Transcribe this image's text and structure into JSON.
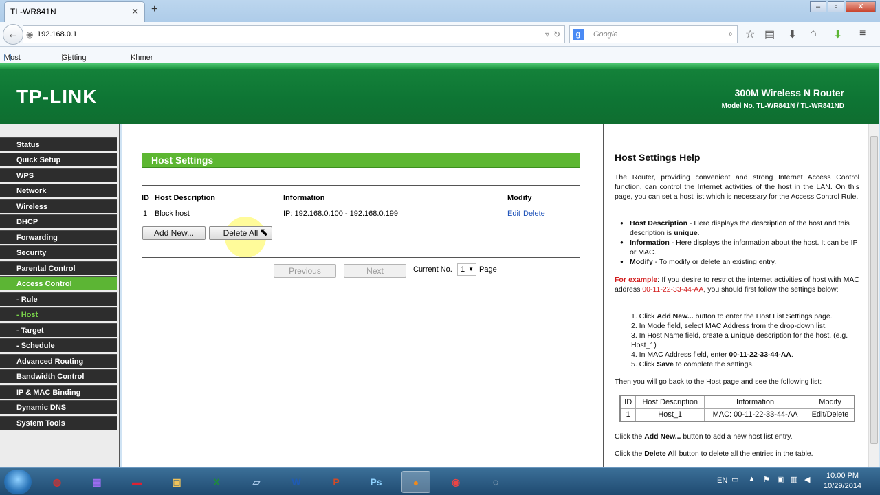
{
  "browser": {
    "tab_title": "TL-WR841N",
    "url": "192.168.0.1",
    "search_placeholder": "Google",
    "bookmarks": [
      "Most Visited",
      "Getting Started",
      "Khmer"
    ]
  },
  "header": {
    "logo": "TP-LINK",
    "product": "300M Wireless N Router",
    "model": "Model No. TL-WR841N / TL-WR841ND"
  },
  "sidebar": {
    "items": [
      "Status",
      "Quick Setup",
      "WPS",
      "Network",
      "Wireless",
      "DHCP",
      "Forwarding",
      "Security",
      "Parental Control",
      "Access Control",
      " - Rule",
      " - Host",
      " - Target",
      " - Schedule",
      "Advanced Routing",
      "Bandwidth Control",
      "IP & MAC Binding",
      "Dynamic DNS",
      "System Tools"
    ]
  },
  "main": {
    "title": "Host Settings",
    "columns": [
      "ID",
      "Host Description",
      "Information",
      "Modify"
    ],
    "rows": [
      {
        "id": "1",
        "desc": "Block host",
        "info": "IP: 192.168.0.100 - 192.168.0.199",
        "edit": "Edit",
        "delete": "Delete"
      }
    ],
    "add_label": "Add New...",
    "delete_all_label": "Delete All",
    "prev_label": "Previous",
    "next_label": "Next",
    "current_label": "Current No.",
    "page_value": "1",
    "page_label": "Page"
  },
  "help": {
    "title": "Host Settings Help",
    "intro": "The Router, providing convenient and strong Internet Access Control function, can control the Internet activities of the host in the LAN. On this page, you can set a host list which is necessary for the Access Control Rule.",
    "b1_term": "Host Description",
    "b1_text": " - Here displays the description of the host and this description is ",
    "b1_bold": "unique",
    "b1_end": ".",
    "b2_term": "Information",
    "b2_text": " - Here displays the information about the host. It can be IP or MAC.",
    "b3_term": "Modify",
    "b3_text": " - To modify or delete an existing entry.",
    "ex_term": "For example",
    "ex_text1": ": If you desire to restrict the internet activities of host with MAC address ",
    "ex_mac": "00-11-22-33-44-AA",
    "ex_text2": ", you should first follow the settings below:",
    "steps": [
      [
        "1. Click ",
        "Add New...",
        " button to enter the Host List Settings page."
      ],
      [
        "2. In Mode field, select MAC Address from the drop-down list.",
        "",
        ""
      ],
      [
        "3. In Host Name field, create a ",
        "unique",
        " description for the host. (e.g. Host_1)"
      ],
      [
        "4. In MAC Address field, enter ",
        "00-11-22-33-44-AA",
        "."
      ],
      [
        "5. Click ",
        "Save",
        " to complete the settings."
      ]
    ],
    "then_text": "Then you will go back to the Host page and see the following list:",
    "table_head": [
      "ID",
      "Host Description",
      "Information",
      "Modify"
    ],
    "table_row": [
      "1",
      "Host_1",
      "MAC: 00-11-22-33-44-AA",
      "Edit/Delete"
    ],
    "add_pre": "Click the ",
    "add_b": "Add New...",
    "add_post": " button to add a new host list entry.",
    "del_pre": "Click the ",
    "del_b": "Delete All",
    "del_post": " button to delete all the entries in the table."
  },
  "taskbar": {
    "lang": "EN",
    "time": "10:00 PM",
    "date": "10/29/2014"
  }
}
